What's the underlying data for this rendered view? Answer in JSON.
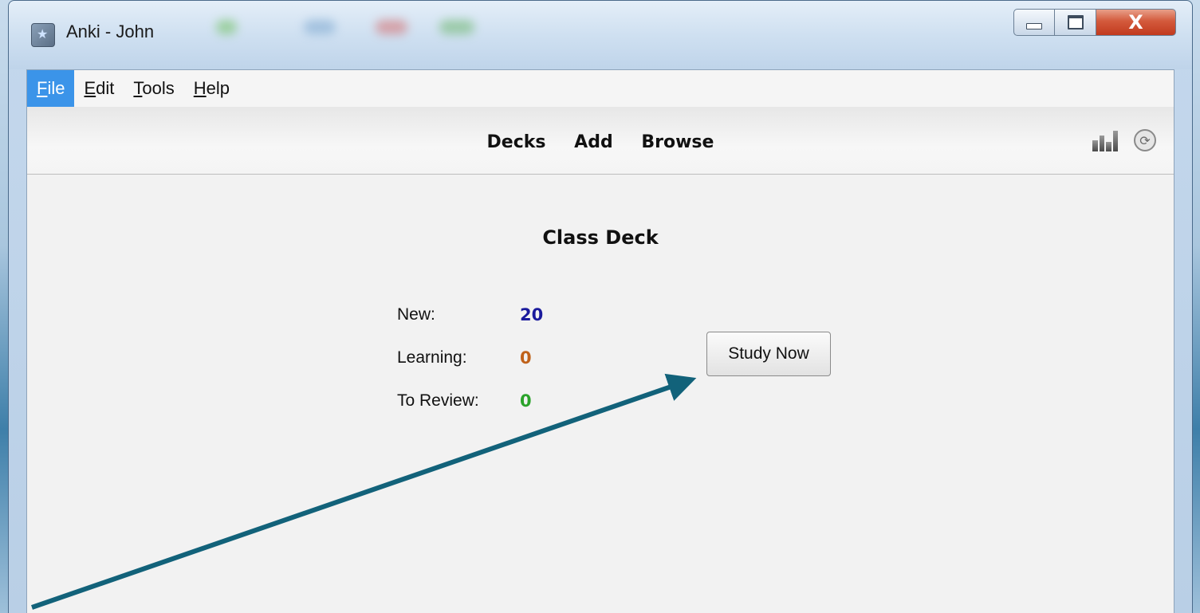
{
  "window": {
    "title": "Anki - John",
    "buttons": {
      "minimize": "minimize",
      "maximize": "maximize",
      "close": "X"
    }
  },
  "menu": [
    {
      "label": "File",
      "mnemonic": "F",
      "rest": "ile",
      "active": true
    },
    {
      "label": "Edit",
      "mnemonic": "E",
      "rest": "dit"
    },
    {
      "label": "Tools",
      "mnemonic": "T",
      "rest": "ools"
    },
    {
      "label": "Help",
      "mnemonic": "H",
      "rest": "elp"
    }
  ],
  "toolbar": {
    "links": [
      "Decks",
      "Add",
      "Browse"
    ],
    "icons": [
      "stats-icon",
      "sync-icon"
    ]
  },
  "deck": {
    "title": "Class Deck",
    "counts": [
      {
        "label": "New:",
        "value": "20",
        "color": "#1a1a9c"
      },
      {
        "label": "Learning:",
        "value": "0",
        "color": "#c0621a"
      },
      {
        "label": "To Review:",
        "value": "0",
        "color": "#2aa32a"
      }
    ],
    "study_button": "Study Now"
  },
  "annotation": {
    "arrow_color": "#12627a"
  }
}
